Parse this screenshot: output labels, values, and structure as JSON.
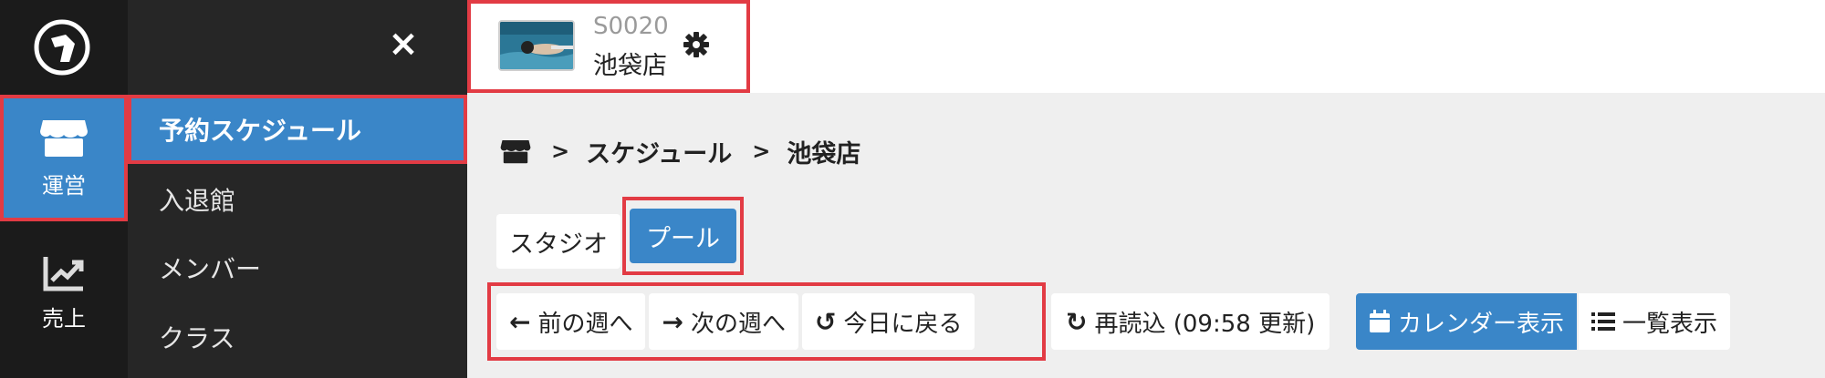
{
  "rail": {
    "items": [
      {
        "label": "運営",
        "icon": "store-icon"
      },
      {
        "label": "売上",
        "icon": "chart-line-icon"
      }
    ]
  },
  "submenu": {
    "close": "×",
    "items": [
      {
        "label": "予約スケジュール"
      },
      {
        "label": "入退館"
      },
      {
        "label": "メンバー"
      },
      {
        "label": "クラス"
      }
    ]
  },
  "store": {
    "code": "S0020",
    "name": "池袋店"
  },
  "breadcrumb": {
    "sep": ">",
    "items": [
      "スケジュール",
      "池袋店"
    ]
  },
  "tabs": [
    "スタジオ",
    "プール"
  ],
  "nav": {
    "prev": "前の週へ",
    "next": "次の週へ",
    "today": "今日に戻る"
  },
  "reload": "再読込 (09:58 更新)",
  "view": {
    "calendar": "カレンダー表示",
    "list": "一覧表示"
  },
  "colors": {
    "primary": "#3a86c8",
    "highlight": "#e23b44",
    "rail_bg": "#1b1b1b",
    "submenu_bg": "#262626"
  }
}
